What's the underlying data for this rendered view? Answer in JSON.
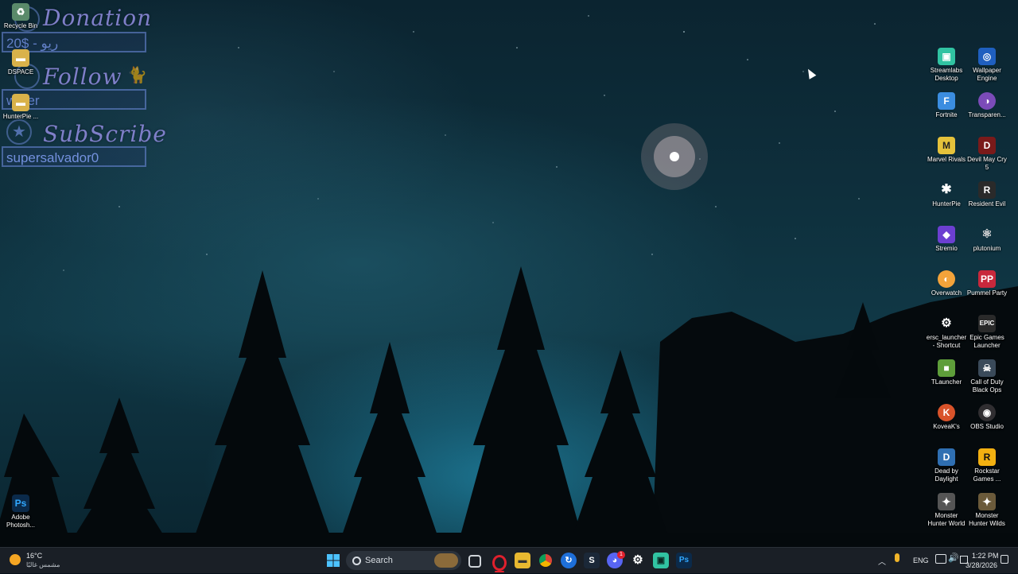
{
  "overlay": {
    "donation_heading": "Donation",
    "donation_value": "20$ - ريو",
    "follow_heading": "Follow",
    "follow_value": "writer",
    "subscribe_heading": "SubScribe",
    "subscribe_value": "supersalvador0"
  },
  "desktop_left": [
    {
      "label": "Recycle Bin",
      "icon": "recycle-bin-icon"
    },
    {
      "label": "DSPACE",
      "icon": "folder-icon"
    },
    {
      "label": "HunterPie ...",
      "icon": "folder-icon"
    },
    {
      "label": "Adobe Photosh...",
      "icon": "photoshop-icon"
    }
  ],
  "desktop_right": [
    {
      "label": "Streamlabs Desktop",
      "icon": "streamlabs-icon"
    },
    {
      "label": "Wallpaper Engine",
      "icon": "wallpaper-engine-icon"
    },
    {
      "label": "Fortnite",
      "icon": "fortnite-icon"
    },
    {
      "label": "Transparen...",
      "icon": "transparent-icon"
    },
    {
      "label": "Marvel Rivals",
      "icon": "marvel-rivals-icon"
    },
    {
      "label": "Devil May Cry 5",
      "icon": "devil-may-cry-icon"
    },
    {
      "label": "HunterPie",
      "icon": "hunterpie-icon"
    },
    {
      "label": "Resident Evil",
      "icon": "resident-evil-icon"
    },
    {
      "label": "Stremio",
      "icon": "stremio-icon"
    },
    {
      "label": "plutonium",
      "icon": "plutonium-icon"
    },
    {
      "label": "Overwatch",
      "icon": "overwatch-icon"
    },
    {
      "label": "Pummel Party",
      "icon": "pummel-party-icon"
    },
    {
      "label": "ersc_launcher - Shortcut",
      "icon": "ersc-launcher-icon"
    },
    {
      "label": "Epic Games Launcher",
      "icon": "epic-games-icon"
    },
    {
      "label": "TLauncher",
      "icon": "tlauncher-icon"
    },
    {
      "label": "Call of Duty Black Ops",
      "icon": "call-of-duty-icon"
    },
    {
      "label": "KoveaK's",
      "icon": "koveak-icon"
    },
    {
      "label": "OBS Studio",
      "icon": "obs-studio-icon"
    },
    {
      "label": "Dead by Daylight",
      "icon": "dead-by-daylight-icon"
    },
    {
      "label": "Rockstar Games ...",
      "icon": "rockstar-games-icon"
    },
    {
      "label": "Monster Hunter World",
      "icon": "monster-hunter-world-icon"
    },
    {
      "label": "Monster Hunter Wilds",
      "icon": "monster-hunter-wilds-icon"
    }
  ],
  "taskbar": {
    "weather_temp": "16°C",
    "weather_desc": "مشمس غالبًا",
    "search_label": "Search",
    "language": "ENG",
    "time": "1:22 PM",
    "date": "3/28/2026",
    "discord_badge": "1"
  },
  "colors": {
    "taskbar_bg": "#1a1f26",
    "overlay_accent": "#7f7fc9",
    "sky_glow": "#28aad2"
  }
}
